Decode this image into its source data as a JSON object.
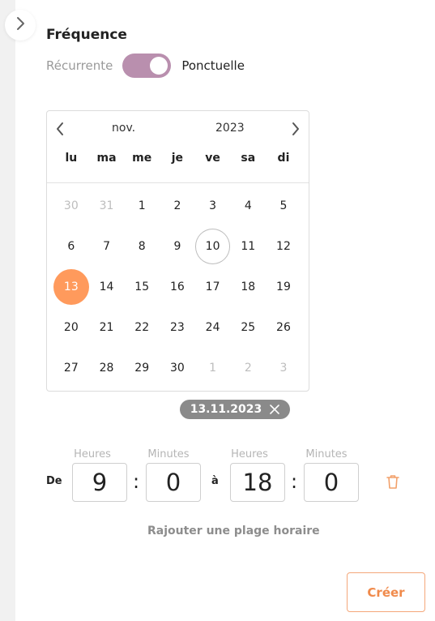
{
  "collapse": {
    "icon": "chevron-right-icon"
  },
  "frequency": {
    "title": "Fréquence",
    "option_left": "Récurrente",
    "option_right": "Ponctuelle",
    "toggle_on": true,
    "toggle_color": "#b98fae"
  },
  "calendar": {
    "month": "nov.",
    "year": "2023",
    "weekdays": [
      "lu",
      "ma",
      "me",
      "je",
      "ve",
      "sa",
      "di"
    ],
    "days": [
      {
        "d": "30",
        "outside": true
      },
      {
        "d": "31",
        "outside": true
      },
      {
        "d": "1"
      },
      {
        "d": "2"
      },
      {
        "d": "3"
      },
      {
        "d": "4"
      },
      {
        "d": "5"
      },
      {
        "d": "6"
      },
      {
        "d": "7"
      },
      {
        "d": "8"
      },
      {
        "d": "9"
      },
      {
        "d": "10",
        "today": true
      },
      {
        "d": "11"
      },
      {
        "d": "12"
      },
      {
        "d": "13",
        "selected": true
      },
      {
        "d": "14"
      },
      {
        "d": "15"
      },
      {
        "d": "16"
      },
      {
        "d": "17"
      },
      {
        "d": "18"
      },
      {
        "d": "19"
      },
      {
        "d": "20"
      },
      {
        "d": "21"
      },
      {
        "d": "22"
      },
      {
        "d": "23"
      },
      {
        "d": "24"
      },
      {
        "d": "25"
      },
      {
        "d": "26"
      },
      {
        "d": "27"
      },
      {
        "d": "28"
      },
      {
        "d": "29"
      },
      {
        "d": "30"
      },
      {
        "d": "1",
        "outside": true
      },
      {
        "d": "2",
        "outside": true
      },
      {
        "d": "3",
        "outside": true
      }
    ],
    "selected_color": "#ff9a5c"
  },
  "selected_chip": {
    "label": "13.11.2023"
  },
  "time_range": {
    "from_label": "De",
    "to_label": "à",
    "hours_label": "Heures",
    "minutes_label": "Minutes",
    "separator": ":",
    "start_hours": "9",
    "start_minutes": "0",
    "end_hours": "18",
    "end_minutes": "0"
  },
  "add_range_label": "Rajouter une plage horaire",
  "create_label": "Créer",
  "accent_color": "#f08a4b"
}
